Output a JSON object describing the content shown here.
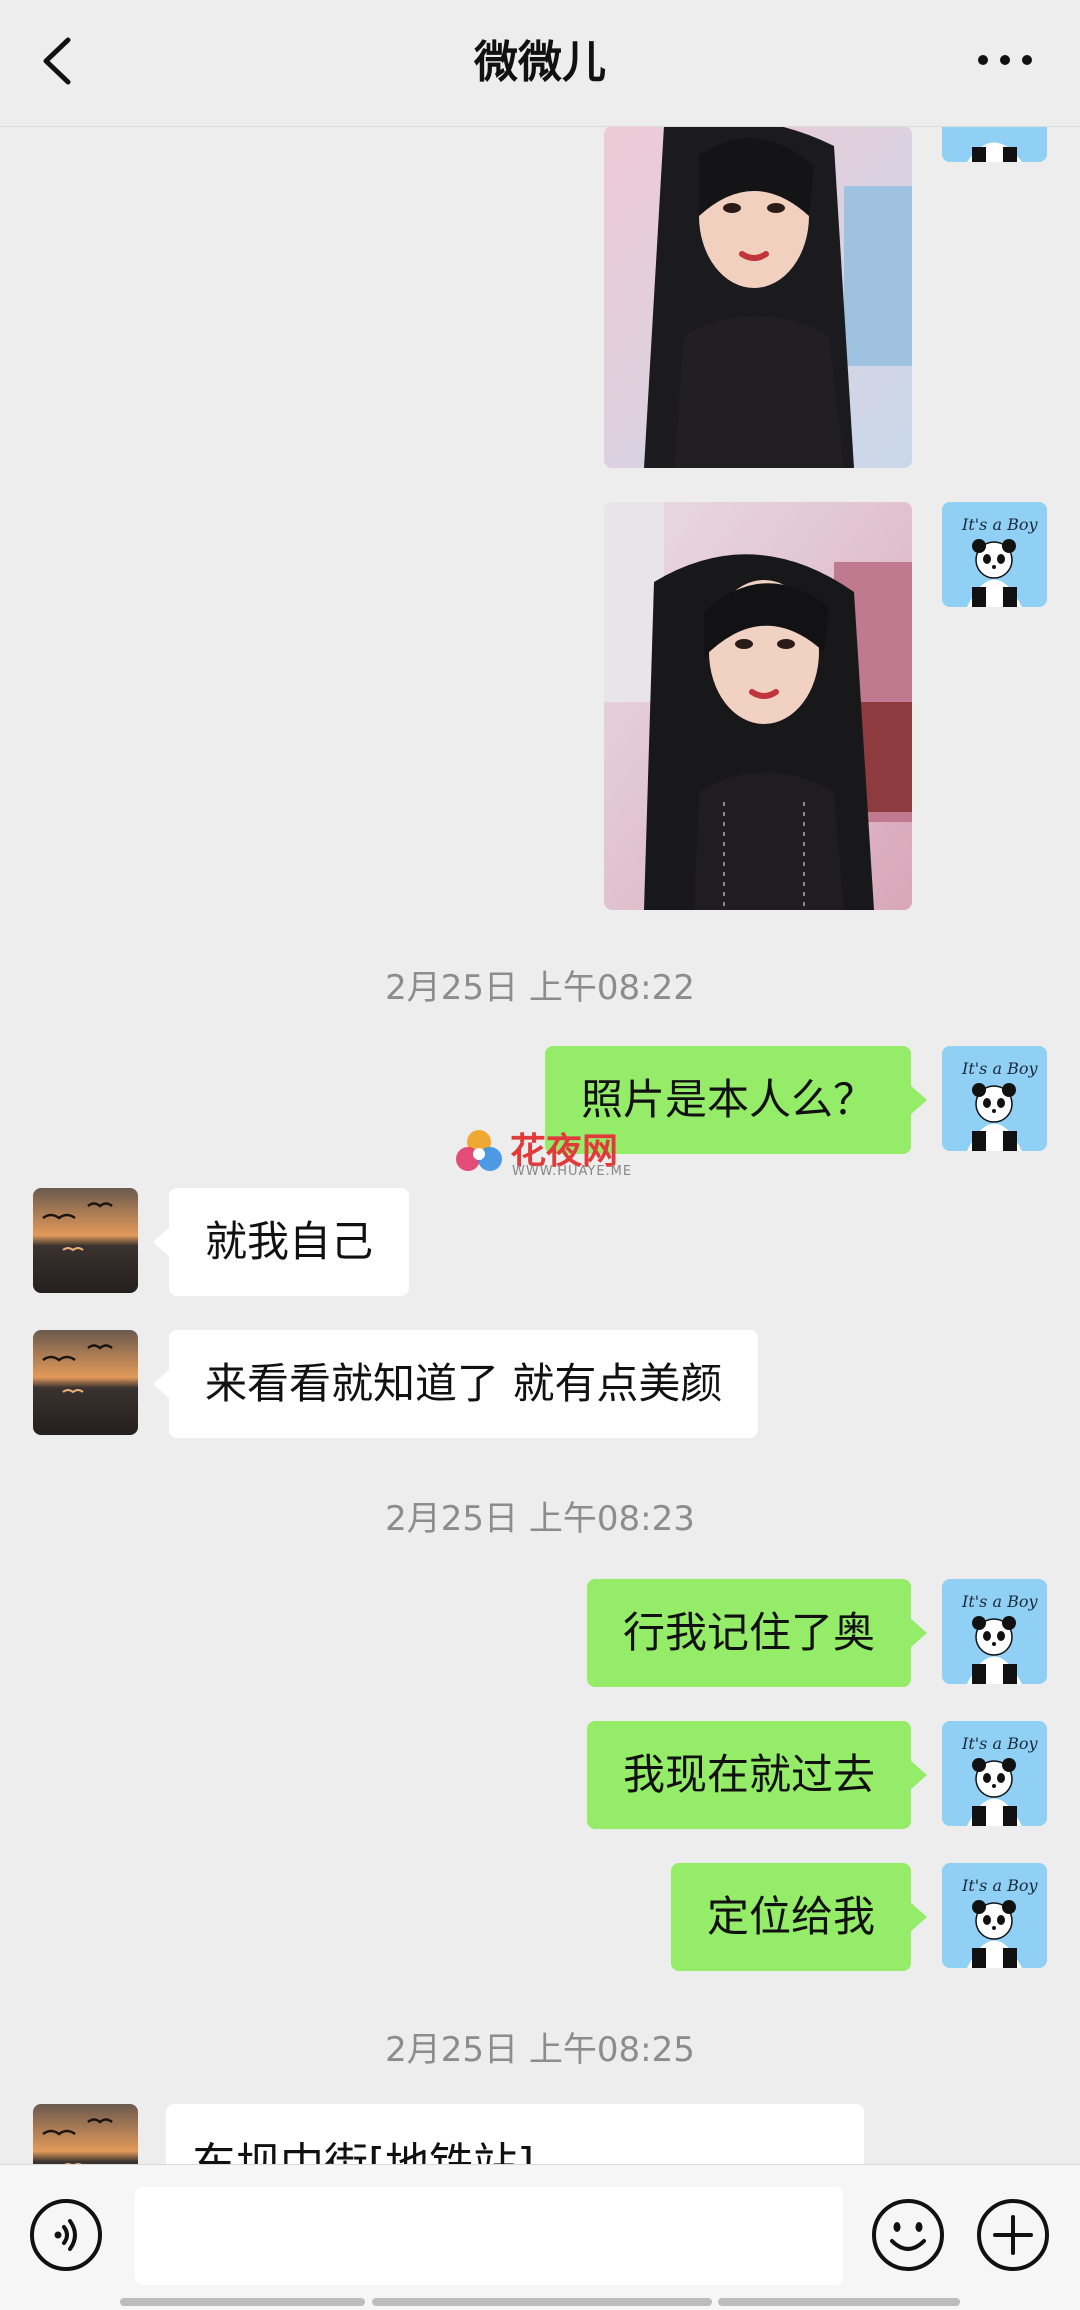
{
  "header": {
    "title": "微微儿",
    "back_icon": "chevron-left-icon",
    "more_icon": "more-dots-icon"
  },
  "avatars": {
    "self": {
      "caption": "It's a Boy",
      "icon": "panda-avatar-icon",
      "bg_color": "#8fd0f4"
    },
    "contact": {
      "icon": "sunset-seagulls-avatar-icon"
    }
  },
  "messages": {
    "ts1": "2月25日 上午08:22",
    "m1": "照片是本人么？",
    "m2": "就我自己",
    "m3": "来看看就知道了 就有点美颜",
    "ts2": "2月25日 上午08:23",
    "m4": "行我记住了奥",
    "m5": "我现在就过去",
    "m6": "定位给我",
    "ts3": "2月25日 上午08:25",
    "location_title": "东坝中街[地铁站]"
  },
  "watermark": {
    "text": "花夜网",
    "url": "WWW.HUAYE.ME"
  },
  "input": {
    "value": "",
    "placeholder": "",
    "voice_icon": "voice-icon",
    "emoji_icon": "emoji-icon",
    "plus_icon": "plus-icon"
  },
  "colors": {
    "background": "#ededed",
    "sent_bubble": "#95ec69",
    "received_bubble": "#ffffff",
    "timestamp": "#8c8c8c"
  }
}
